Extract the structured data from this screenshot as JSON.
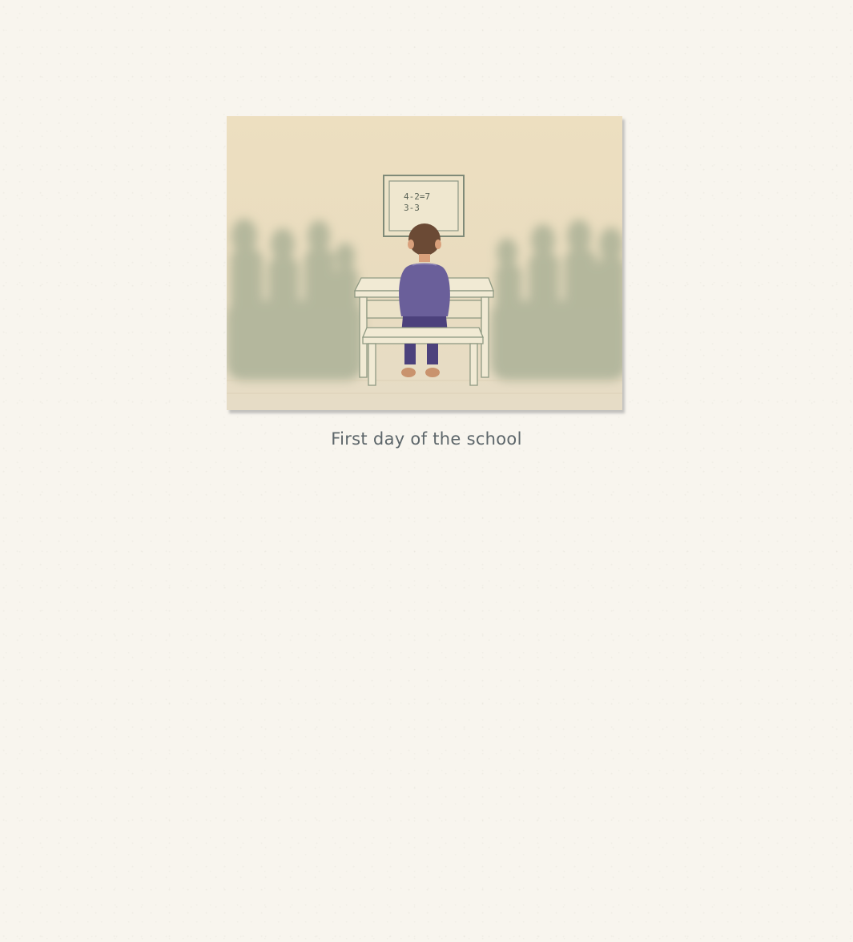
{
  "illustration": {
    "blackboard_lines": [
      "4-2=7",
      "3-3"
    ],
    "colors": {
      "paper": "#ecdfc2",
      "haze": "#9ea88f",
      "desk": "#f1ead4",
      "desk_outline": "#8f9a83",
      "sweater": "#6a5f9a",
      "pants": "#4c417c",
      "hair": "#6b4a35",
      "skin": "#d9a07b"
    }
  },
  "caption": "First day of the school"
}
